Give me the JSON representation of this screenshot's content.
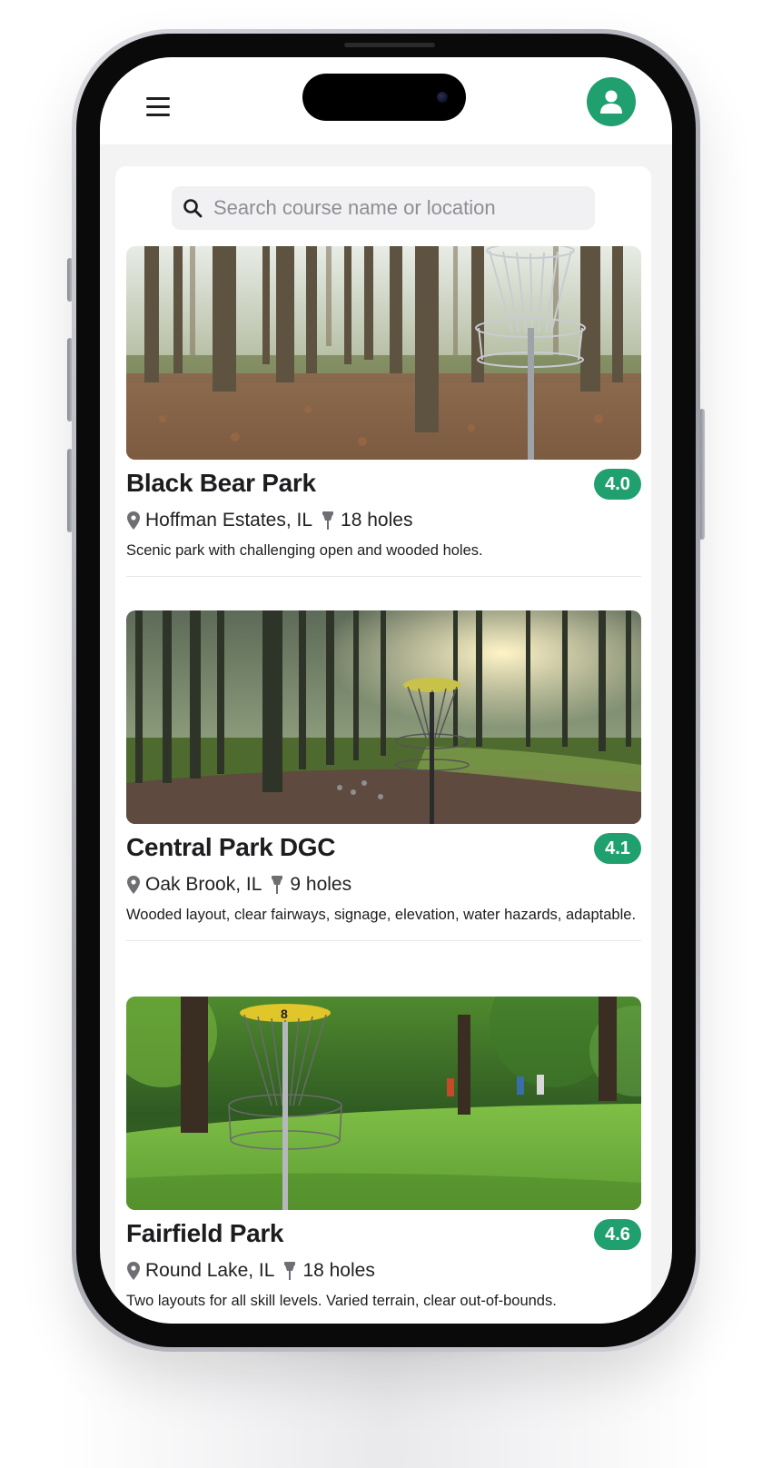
{
  "header": {
    "menu_icon": "hamburger-menu-icon",
    "profile_icon": "user-avatar-icon",
    "accent_color": "#21a06f"
  },
  "search": {
    "placeholder": "Search course name or location",
    "value": "",
    "icon": "search-icon"
  },
  "courses": [
    {
      "name": "Black Bear Park",
      "rating": "4.0",
      "location": "Hoffman Estates, IL",
      "holes": "18 holes",
      "description": "Scenic park with challenging open and wooded holes."
    },
    {
      "name": "Central Park DGC",
      "rating": "4.1",
      "location": "Oak Brook, IL",
      "holes": "9 holes",
      "description": "Wooded layout, clear fairways, signage, elevation, water hazards, adaptable."
    },
    {
      "name": "Fairfield Park",
      "rating": "4.6",
      "location": "Round Lake, IL",
      "holes": "18 holes",
      "description": "Two layouts for all skill levels. Varied terrain, clear out-of-bounds."
    }
  ],
  "basket_number": "8"
}
